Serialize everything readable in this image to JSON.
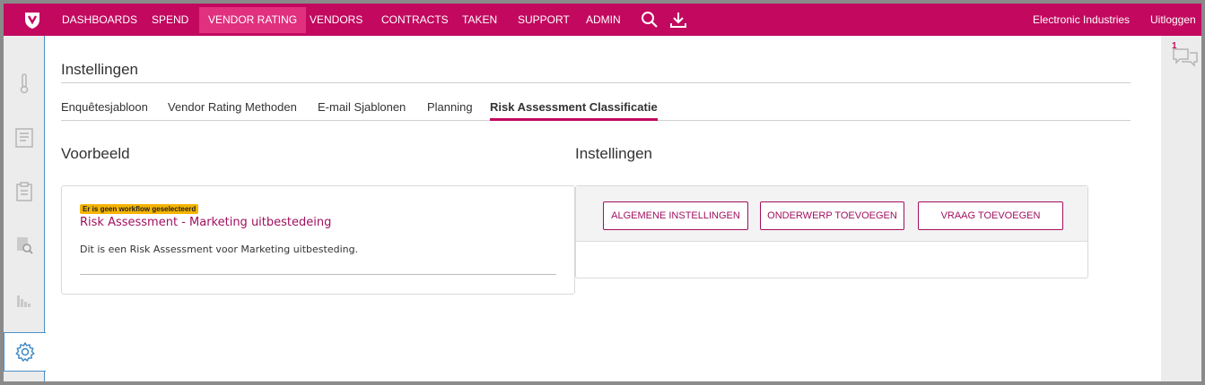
{
  "topbar": {
    "nav": [
      "DASHBOARDS",
      "SPEND",
      "VENDOR RATING",
      "VENDORS",
      "CONTRACTS",
      "TAKEN",
      "SUPPORT",
      "ADMIN"
    ],
    "active_nav": "VENDOR RATING",
    "company": "Electronic Industries",
    "logout": "Uitloggen",
    "brand_color": "#c2095f"
  },
  "chat": {
    "count": "1"
  },
  "page": {
    "title": "Instellingen",
    "tabs": [
      "Enquêtesjabloon",
      "Vendor Rating Methoden",
      "E-mail Sjablonen",
      "Planning",
      "Risk Assessment Classificatie"
    ],
    "active_tab": "Risk Assessment Classificatie"
  },
  "preview": {
    "heading": "Voorbeeld",
    "badge": "Er is geen workflow geselecteerd",
    "title": "Risk Assessment - Marketing uitbestedeing",
    "description": "Dit is een Risk Assessment voor Marketing uitbesteding."
  },
  "settings": {
    "heading": "Instellingen",
    "buttons": [
      "ALGEMENE INSTELLINGEN",
      "ONDERWERP TOEVOEGEN",
      "VRAAG TOEVOEGEN"
    ]
  }
}
